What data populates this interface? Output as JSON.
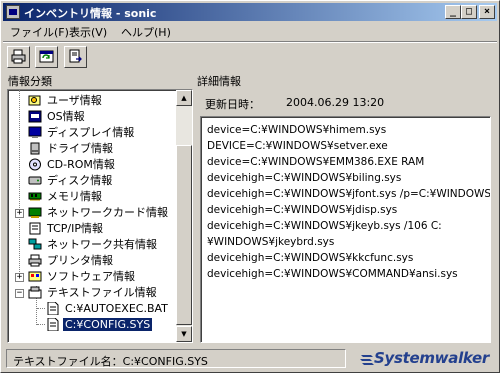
{
  "window": {
    "title": "インベントリ情報 - sonic"
  },
  "title_buttons": {
    "minimize": "_",
    "maximize": "□",
    "close": "×"
  },
  "menubar": [
    {
      "label": "ファイル(F)"
    },
    {
      "label": "表示(V)"
    },
    {
      "label": "ヘルプ(H)"
    }
  ],
  "toolbar": [
    {
      "icon": "print-icon"
    },
    {
      "icon": "refresh-icon"
    },
    {
      "icon": "export-icon"
    }
  ],
  "left_panel": {
    "label": "情報分類"
  },
  "right_panel": {
    "label": "詳細情報"
  },
  "tree": [
    {
      "label": "ユーザ情報",
      "icon": "user-info-icon"
    },
    {
      "label": "OS情報",
      "icon": "os-icon"
    },
    {
      "label": "ディスプレイ情報",
      "icon": "display-icon"
    },
    {
      "label": "ドライブ情報",
      "icon": "drive-icon"
    },
    {
      "label": "CD-ROM情報",
      "icon": "cdrom-icon"
    },
    {
      "label": "ディスク情報",
      "icon": "disk-icon"
    },
    {
      "label": "メモリ情報",
      "icon": "memory-icon"
    },
    {
      "label": "ネットワークカード情報",
      "icon": "network-card-icon",
      "expander": "+"
    },
    {
      "label": "TCP/IP情報",
      "icon": "tcpip-icon"
    },
    {
      "label": "ネットワーク共有情報",
      "icon": "network-share-icon"
    },
    {
      "label": "プリンタ情報",
      "icon": "printer-icon"
    },
    {
      "label": "ソフトウェア情報",
      "icon": "software-icon",
      "expander": "+"
    },
    {
      "label": "テキストファイル情報",
      "icon": "text-file-icon",
      "expander": "−"
    },
    {
      "label": "C:¥AUTOEXEC.BAT",
      "icon": "document-icon",
      "child": true
    },
    {
      "label": "C:¥CONFIG.SYS",
      "icon": "document-icon",
      "child": true,
      "selected": true
    }
  ],
  "detail": {
    "date_label": "更新日時：",
    "date_value": "2004.06.29 13:20",
    "lines": [
      "device=C:¥WINDOWS¥himem.sys",
      "DEVICE=C:¥WINDOWS¥setver.exe",
      "device=C:¥WINDOWS¥EMM386.EXE RAM",
      "devicehigh=C:¥WINDOWS¥biling.sys",
      "devicehigh=C:¥WINDOWS¥jfont.sys /p=C:¥WINDOWS",
      "devicehigh=C:¥WINDOWS¥jdisp.sys",
      "devicehigh=C:¥WINDOWS¥jkeyb.sys /106 C:",
      "¥WINDOWS¥jkeybrd.sys",
      "devicehigh=C:¥WINDOWS¥kkcfunc.sys",
      "devicehigh=C:¥WINDOWS¥COMMAND¥ansi.sys"
    ]
  },
  "status": {
    "text": "テキストファイル名：C:¥CONFIG.SYS"
  },
  "brand": {
    "name": "Systemwalker",
    "color": "#23408e"
  }
}
